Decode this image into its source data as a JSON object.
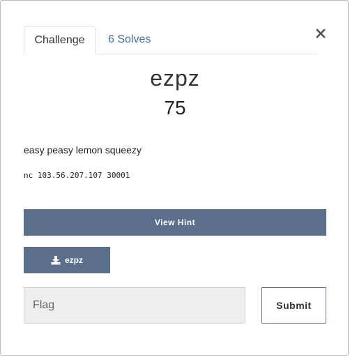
{
  "tabs": {
    "challenge": "Challenge",
    "solves": "6 Solves"
  },
  "close_icon": "×",
  "challenge": {
    "name": "ezpz",
    "value": "75",
    "description": "easy peasy lemon squeezy",
    "connection": "nc 103.56.207.107 30001"
  },
  "buttons": {
    "view_hint": "View Hint",
    "file": "ezpz",
    "submit": "Submit"
  },
  "flag_input": {
    "placeholder": "Flag",
    "value": ""
  },
  "colors": {
    "button_bg": "#5b6f8d",
    "link": "#3f6f9e"
  },
  "icons": {
    "close": "close-icon",
    "download": "download-icon"
  }
}
